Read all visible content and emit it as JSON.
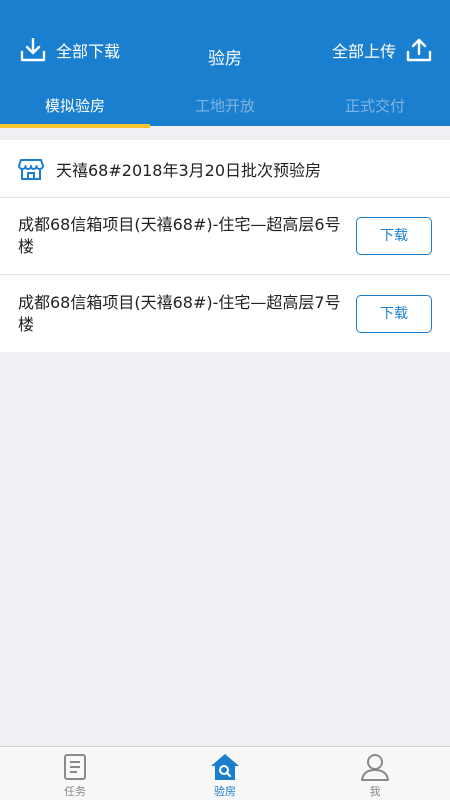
{
  "header": {
    "title": "验房",
    "download_all": "全部下载",
    "upload_all": "全部上传"
  },
  "tabs": [
    {
      "label": "模拟验房",
      "active": true
    },
    {
      "label": "工地开放",
      "active": false
    },
    {
      "label": "正式交付",
      "active": false
    }
  ],
  "batch": {
    "title": "天禧68#2018年3月20日批次预验房",
    "icon": "store-icon"
  },
  "items": [
    {
      "name": "成都68信箱项目(天禧68#)-住宅—超高层6号楼",
      "button": "下载"
    },
    {
      "name": "成都68信箱项目(天禧68#)-住宅—超高层7号楼",
      "button": "下载"
    }
  ],
  "nav": [
    {
      "label": "任务",
      "icon": "document-icon",
      "active": false
    },
    {
      "label": "验房",
      "icon": "house-search-icon",
      "active": true
    },
    {
      "label": "我",
      "icon": "user-icon",
      "active": false
    }
  ],
  "colors": {
    "primary": "#1b7fd0",
    "tab_indicator": "#f7c531"
  }
}
